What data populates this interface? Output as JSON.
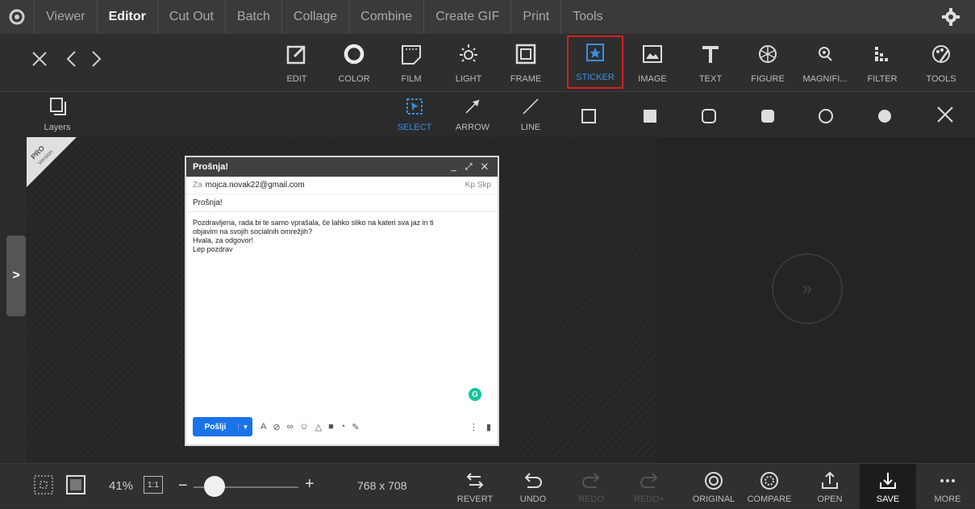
{
  "menu": {
    "items": [
      "Viewer",
      "Editor",
      "Cut Out",
      "Batch",
      "Collage",
      "Combine",
      "Create GIF",
      "Print",
      "Tools"
    ],
    "active": "Editor"
  },
  "toolbar": {
    "tools": [
      {
        "label": "EDIT",
        "icon": "edit-icon"
      },
      {
        "label": "COLOR",
        "icon": "color-icon"
      },
      {
        "label": "FILM",
        "icon": "film-icon"
      },
      {
        "label": "LIGHT",
        "icon": "light-icon"
      },
      {
        "label": "FRAME",
        "icon": "frame-icon"
      },
      {
        "label": "STICKER",
        "icon": "sticker-icon"
      },
      {
        "label": "IMAGE",
        "icon": "image-icon"
      },
      {
        "label": "TEXT",
        "icon": "text-icon"
      },
      {
        "label": "FIGURE",
        "icon": "figure-icon"
      },
      {
        "label": "MAGNIFI...",
        "icon": "magnifier-icon"
      },
      {
        "label": "FILTER",
        "icon": "filter-icon"
      },
      {
        "label": "TOOLS",
        "icon": "tools-icon"
      }
    ],
    "selected": "STICKER"
  },
  "subbar": {
    "layers_label": "Layers",
    "select_label": "SELECT",
    "arrow_label": "ARROW",
    "line_label": "LINE"
  },
  "badge": {
    "pro": "PRO",
    "version": "Version"
  },
  "email": {
    "title": "Prošnja!",
    "to_prefix": "Za",
    "to": "mojca.novak22@gmail.com",
    "cc_bcc": "Kp Skp",
    "subject": "Prošnja!",
    "body_lines": [
      "Pozdravljena, rada bi te samo vprašala, če lahko sliko na kateri sva jaz in ti",
      "objavim na svojih socialnih omrežjih?",
      "Hvala, za odgovor!",
      "Lep pozdrav"
    ],
    "send_label": "Pošlji",
    "grammarly": "G"
  },
  "bottom": {
    "zoom": "41%",
    "one_to_one": "1:1",
    "dimensions": "768 x 708",
    "zoom_fraction": 0.2,
    "revert": "REVERT",
    "undo": "UNDO",
    "redo": "REDO",
    "redo_plus": "REDO+",
    "original": "ORIGINAL",
    "compare": "COMPARE",
    "open": "OPEN",
    "save": "SAVE",
    "more": "MORE"
  },
  "colors": {
    "accent": "#3a8ee6",
    "selection": "#d81f1f",
    "send": "#1a73e8"
  }
}
